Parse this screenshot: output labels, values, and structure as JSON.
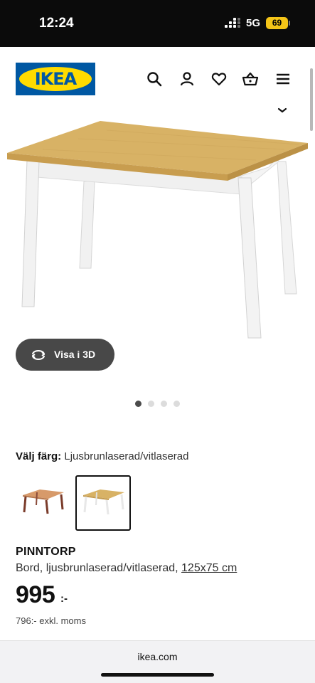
{
  "status": {
    "time": "12:24",
    "network": "5G",
    "battery": "69"
  },
  "header": {
    "logo": "IKEA",
    "icons": [
      "search-icon",
      "user-icon",
      "heart-icon",
      "basket-icon",
      "menu-icon"
    ]
  },
  "product_image": {
    "view_3d_label": "Visa i 3D",
    "active_image_index": 1,
    "image_count": 4
  },
  "color": {
    "label": "Välj färg:",
    "value": "Ljusbrunlaserad/vitlaserad",
    "selected_index": 2
  },
  "product": {
    "name": "PINNTORP",
    "description": "Bord, ljusbrunlaserad/vitlaserad,",
    "size": "125x75 cm",
    "price": "995",
    "price_suffix": ":-",
    "price_ex_vat": "796:- exkl. moms"
  },
  "browser": {
    "url": "ikea.com"
  }
}
